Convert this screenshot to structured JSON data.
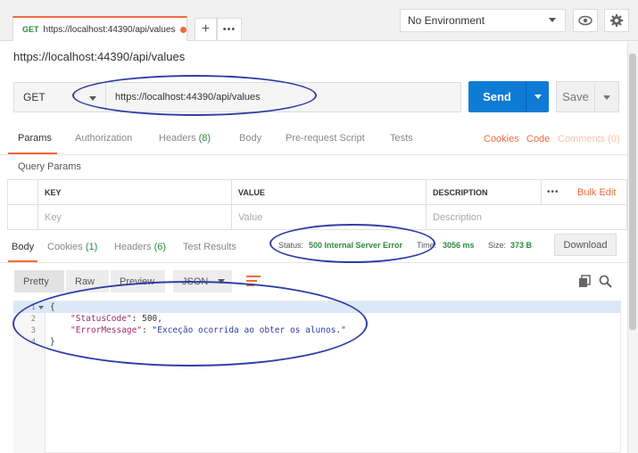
{
  "tab": {
    "method": "GET",
    "url": "https://localhost:44390/api/values"
  },
  "environment": {
    "selected": "No Environment"
  },
  "request": {
    "title": "https://localhost:44390/api/values",
    "method": "GET",
    "url": "https://localhost:44390/api/values",
    "send_label": "Send",
    "save_label": "Save"
  },
  "request_tabs": {
    "params": "Params",
    "authorization": "Authorization",
    "headers": "Headers",
    "headers_count": "(8)",
    "body": "Body",
    "prerequest": "Pre-request Script",
    "tests": "Tests",
    "cookies": "Cookies",
    "code": "Code",
    "comments": "Comments (0)"
  },
  "query_params": {
    "label": "Query Params",
    "col_key": "KEY",
    "col_value": "VALUE",
    "col_description": "DESCRIPTION",
    "more": "•••",
    "bulk_edit": "Bulk Edit",
    "key_placeholder": "Key",
    "value_placeholder": "Value",
    "description_placeholder": "Description"
  },
  "response_tabs": {
    "body": "Body",
    "cookies": "Cookies",
    "cookies_count": "(1)",
    "headers": "Headers",
    "headers_count": "(6)",
    "test_results": "Test Results"
  },
  "response_status": {
    "status_label": "Status:",
    "status_value": "500 Internal Server Error",
    "time_label": "Time:",
    "time_value": "3056 ms",
    "size_label": "Size:",
    "size_value": "373 B",
    "download_label": "Download"
  },
  "view_options": {
    "pretty": "Pretty",
    "raw": "Raw",
    "preview": "Preview",
    "format": "JSON"
  },
  "response_body": {
    "line_numbers": [
      "1",
      "2",
      "3",
      "4"
    ],
    "open_brace": "{",
    "close_brace": "}",
    "key1": "\"StatusCode\"",
    "val1": "500,",
    "key2": "\"ErrorMessage\"",
    "val2": "\"Exceção ocorrida ao obter os alunos.\""
  },
  "colors": {
    "accent": "#f26b3a",
    "send": "#0e7bd5",
    "success_text": "#2b8a3e",
    "annotation": "#2f3ea8"
  }
}
